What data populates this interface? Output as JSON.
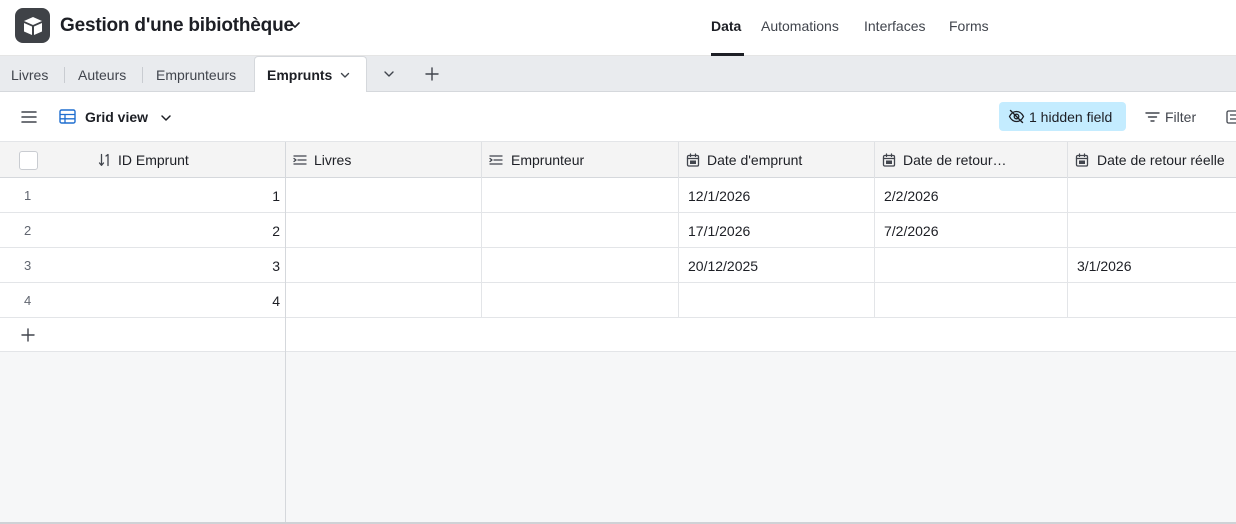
{
  "header": {
    "base_title": "Gestion d'une bibiothèque",
    "nav": [
      "Data",
      "Automations",
      "Interfaces",
      "Forms"
    ],
    "active_nav": "Data"
  },
  "tabs": {
    "items": [
      "Livres",
      "Auteurs",
      "Emprunteurs"
    ],
    "active": "Emprunts"
  },
  "toolbar": {
    "view_name": "Grid view",
    "hidden_fields": "1 hidden field",
    "filter": "Filter"
  },
  "grid": {
    "columns": [
      {
        "label": "ID Emprunt",
        "icon": "sort-desc-icon"
      },
      {
        "label": "Livres",
        "icon": "linked-record-icon"
      },
      {
        "label": "Emprunteur",
        "icon": "linked-record-icon"
      },
      {
        "label": "Date d'emprunt",
        "icon": "calendar-icon"
      },
      {
        "label": "Date de retour…",
        "icon": "calendar-icon"
      },
      {
        "label": "Date de retour réelle",
        "icon": "calendar-icon"
      }
    ],
    "rows": [
      {
        "num": "1",
        "id": "1",
        "livres": "",
        "emprunteur": "",
        "date_emprunt": "12/1/2026",
        "date_retour": "2/2/2026",
        "date_retour_reelle": ""
      },
      {
        "num": "2",
        "id": "2",
        "livres": "",
        "emprunteur": "",
        "date_emprunt": "17/1/2026",
        "date_retour": "7/2/2026",
        "date_retour_reelle": ""
      },
      {
        "num": "3",
        "id": "3",
        "livres": "",
        "emprunteur": "",
        "date_emprunt": "20/12/2025",
        "date_retour": "",
        "date_retour_reelle": "3/1/2026"
      },
      {
        "num": "4",
        "id": "4",
        "livres": "",
        "emprunteur": "",
        "date_emprunt": "",
        "date_retour": "",
        "date_retour_reelle": ""
      }
    ]
  },
  "colors": {
    "accent": "#c4ecff",
    "logo": "#3f4247",
    "grid_icon": "#1f6ecf"
  }
}
